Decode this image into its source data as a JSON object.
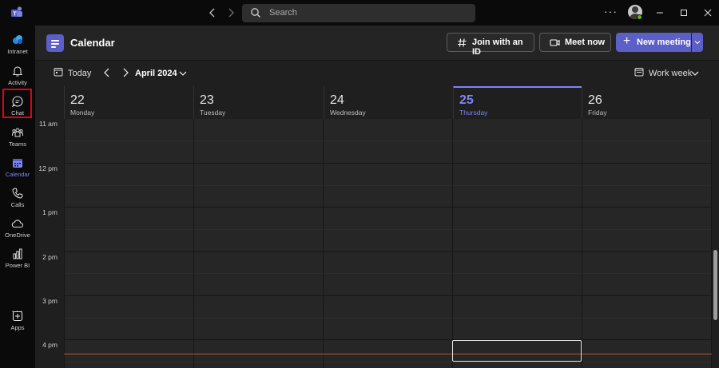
{
  "titlebar": {
    "search_placeholder": "Search",
    "more_label": "···"
  },
  "rail": {
    "items": [
      {
        "label": "Intranet",
        "icon": "intranet-icon"
      },
      {
        "label": "Activity",
        "icon": "bell-icon"
      },
      {
        "label": "Chat",
        "icon": "chat-icon"
      },
      {
        "label": "Teams",
        "icon": "teams-icon"
      },
      {
        "label": "Calendar",
        "icon": "calendar-icon",
        "active": true
      },
      {
        "label": "Calls",
        "icon": "phone-icon"
      },
      {
        "label": "OneDrive",
        "icon": "cloud-icon"
      },
      {
        "label": "Power BI",
        "icon": "powerbi-icon"
      },
      {
        "label": "Apps",
        "icon": "apps-icon"
      }
    ],
    "more_label": "···"
  },
  "header": {
    "title": "Calendar",
    "join_label": "Join with an ID",
    "meet_label": "Meet now",
    "new_meeting_label": "New meeting",
    "new_meeting_plus": "+"
  },
  "toolbar": {
    "today_label": "Today",
    "month_label": "April 2024",
    "view_label": "Work week"
  },
  "days": [
    {
      "num": "22",
      "name": "Monday"
    },
    {
      "num": "23",
      "name": "Tuesday"
    },
    {
      "num": "24",
      "name": "Wednesday"
    },
    {
      "num": "25",
      "name": "Thursday",
      "today": true
    },
    {
      "num": "26",
      "name": "Friday"
    }
  ],
  "hours": [
    "11 am",
    "12 pm",
    "1 pm",
    "2 pm",
    "3 pm",
    "4 pm"
  ],
  "colors": {
    "accent": "#7f85f5",
    "brand": "#5b5fc7",
    "now_line": "#c4541e",
    "highlight_box": "#e0001b"
  }
}
